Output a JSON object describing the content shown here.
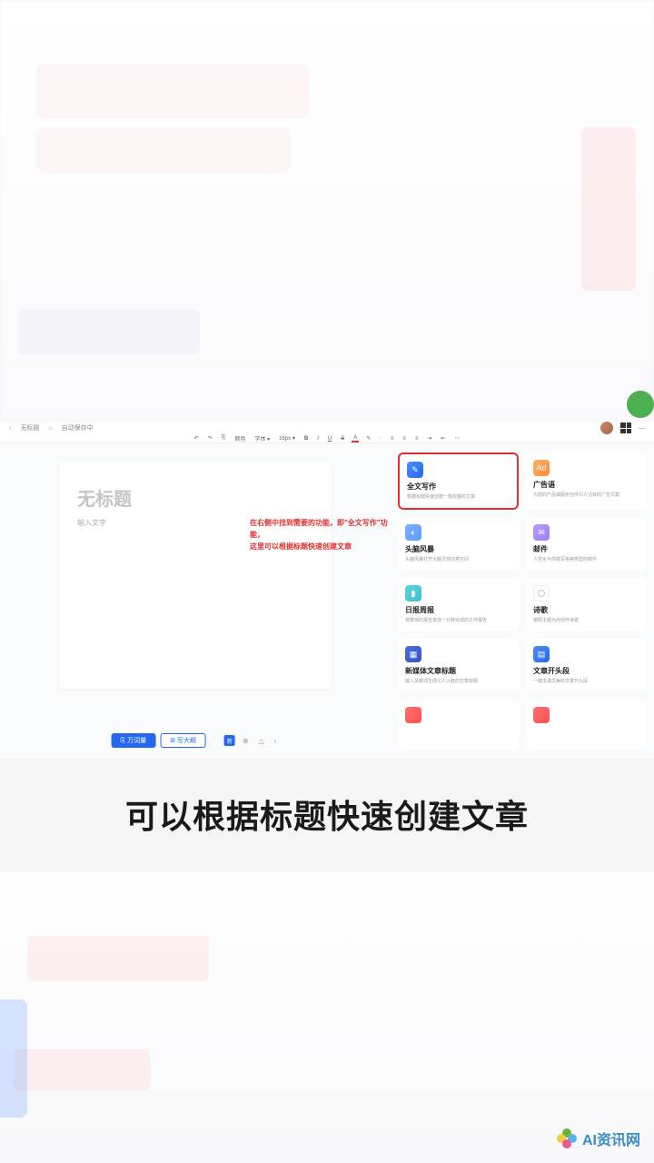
{
  "topbar": {
    "back": "‹",
    "page": "无标题",
    "save_icon": "⌂",
    "save_text": "自动保存中"
  },
  "toolbar": {
    "undo": "↶",
    "redo": "↷",
    "format": "⎘",
    "reset": "颜色",
    "font": "字体 ▾",
    "size": "16px ▾",
    "bold": "B",
    "italic": "I",
    "underline": "U",
    "strike": "S",
    "fontcolor": "A",
    "bgcolor": "✎",
    "alignl": "≡",
    "alignc": "≡",
    "alignr": "≡",
    "indent": "⇥",
    "outdent": "⇤",
    "more": "⋯"
  },
  "doc": {
    "title": "无标题",
    "subtitle": "输入文字"
  },
  "annotation": {
    "line1": "在右侧中找到需要的功能，即\"全文写作\"功能，",
    "line2": "这里可以根据标题快速创建文章"
  },
  "bottombar": {
    "btn1": "⎘ 万词量",
    "btn2": "⊞ 写大纲",
    "sq": "新",
    "i1": "⊕",
    "i2": "△",
    "i3": "›"
  },
  "cards": [
    {
      "icon_class": "ic-blue",
      "icon": "✎",
      "title": "全文写作",
      "desc": "根据标题快速创建一篇完整的文章",
      "hl": true
    },
    {
      "icon_class": "ic-orange",
      "icon": "Ad",
      "title": "广告语",
      "desc": "为您的产品或服务创作引人注目的广告文案"
    },
    {
      "icon_class": "ic-lblue",
      "icon": "◐",
      "title": "头脑风暴",
      "desc": "头脑风暴打开大脑灵感创意空间"
    },
    {
      "icon_class": "ic-purple",
      "icon": "✉",
      "title": "邮件",
      "desc": "人性化与你撰写各种类型的邮件"
    },
    {
      "icon_class": "ic-teal",
      "icon": "▮",
      "title": "日报周报",
      "desc": "将繁琐的报告变成一分钟完成的工作报告"
    },
    {
      "icon_class": "ic-paper",
      "icon": "",
      "title": "诗歌",
      "desc": "按照主题为你创作诗歌"
    },
    {
      "icon_class": "ic-navy",
      "icon": "▦",
      "title": "新媒体文章标题",
      "desc": "输入关键词生成引人入胜的文章标题"
    },
    {
      "icon_class": "ic-blue",
      "icon": "▤",
      "title": "文章开头段",
      "desc": "一键生成优美的文章开头段"
    },
    {
      "icon_class": "ic-red",
      "icon": "",
      "title": "",
      "desc": ""
    },
    {
      "icon_class": "ic-red",
      "icon": "",
      "title": "",
      "desc": ""
    }
  ],
  "caption": "可以根据标题快速创建文章",
  "watermark": "AI资讯网"
}
